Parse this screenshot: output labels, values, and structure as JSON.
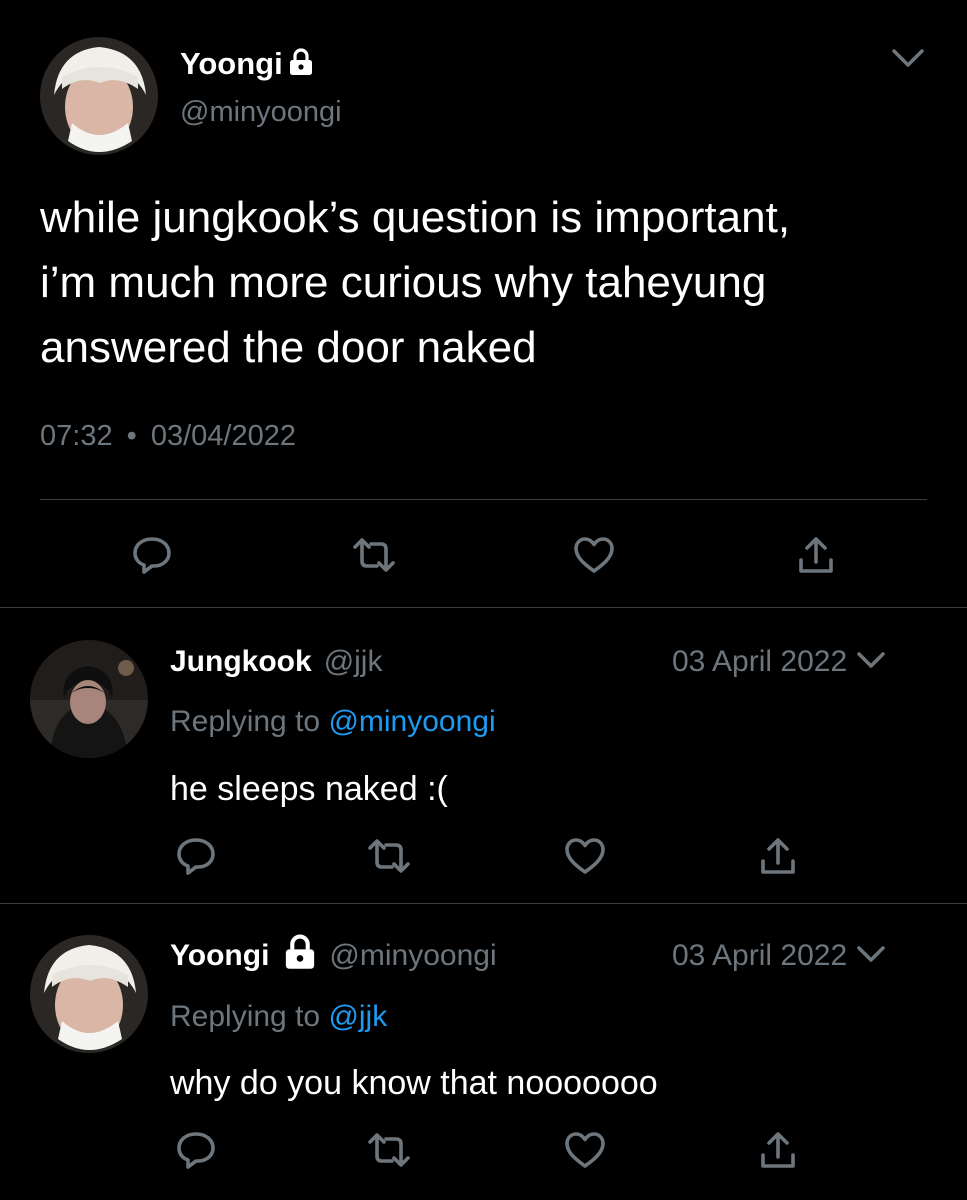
{
  "main_tweet": {
    "display_name": "Yoongi",
    "handle": "@minyoongi",
    "text_line1": "while jungkook’s question is important,",
    "text_line2": "i’m much more curious why taheyung",
    "text_line3": "answered the door naked",
    "time": "07:32",
    "separator": "•",
    "date": "03/04/2022"
  },
  "reply1": {
    "display_name": "Jungkook",
    "handle": "@jjk",
    "date": "03 April 2022",
    "replying_prefix": "Replying to",
    "replying_handle": "@minyoongi",
    "text": "he sleeps naked :("
  },
  "reply2": {
    "display_name": "Yoongi",
    "handle": "@minyoongi",
    "date": "03 April 2022",
    "replying_prefix": "Replying to",
    "replying_handle": "@jjk",
    "text": "why do you know that nooooooo"
  },
  "colors": {
    "background": "#000000",
    "text": "#ffffff",
    "muted": "#6e767d",
    "link": "#1d9bf0",
    "divider": "#3a3d40"
  },
  "icons": [
    "lock-icon",
    "chevron-down-icon",
    "reply-icon",
    "retweet-icon",
    "like-icon",
    "share-icon"
  ]
}
